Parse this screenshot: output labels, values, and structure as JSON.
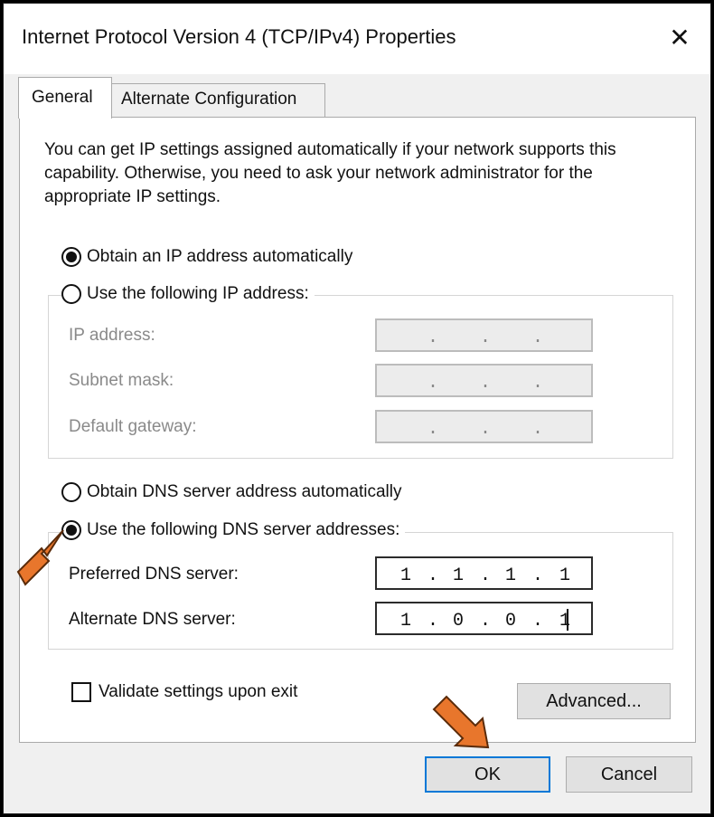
{
  "window": {
    "title": "Internet Protocol Version 4 (TCP/IPv4) Properties",
    "close_glyph": "✕"
  },
  "tabs": [
    {
      "label": "General",
      "active": true
    },
    {
      "label": "Alternate Configuration",
      "active": false
    }
  ],
  "intro": "You can get IP settings assigned automatically if your network supports this capability. Otherwise, you need to ask your network administrator for the appropriate IP settings.",
  "ip": {
    "auto_label": "Obtain an IP address automatically",
    "manual_label": "Use the following IP address:",
    "selected": "auto",
    "fields": [
      {
        "label": "IP address:",
        "octets": [
          "",
          "",
          "",
          ""
        ]
      },
      {
        "label": "Subnet mask:",
        "octets": [
          "",
          "",
          "",
          ""
        ]
      },
      {
        "label": "Default gateway:",
        "octets": [
          "",
          "",
          "",
          ""
        ]
      }
    ]
  },
  "dns": {
    "auto_label": "Obtain DNS server address automatically",
    "manual_label": "Use the following DNS server addresses:",
    "selected": "manual",
    "preferred": {
      "label": "Preferred DNS server:",
      "octets": [
        "1",
        "1",
        "1",
        "1"
      ]
    },
    "alternate": {
      "label": "Alternate DNS server:",
      "octets": [
        "1",
        "0",
        "0",
        "1"
      ]
    }
  },
  "validate": {
    "label": "Validate settings upon exit",
    "checked": false
  },
  "buttons": {
    "advanced": "Advanced...",
    "ok": "OK",
    "cancel": "Cancel"
  },
  "colors": {
    "accent": "#0078d7",
    "annotation_arrow": "#e8762c"
  }
}
